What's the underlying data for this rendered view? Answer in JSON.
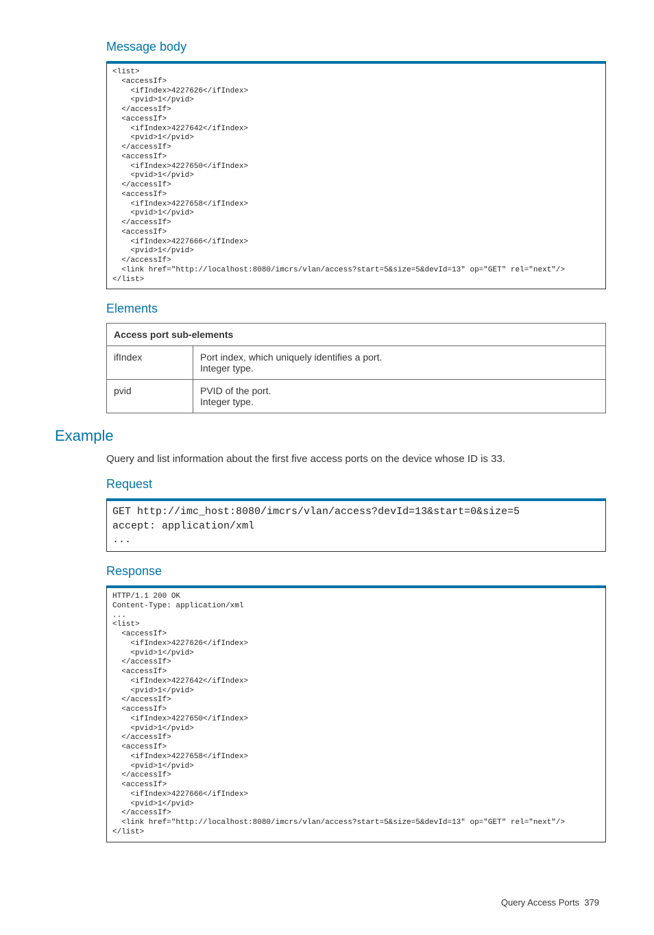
{
  "headings": {
    "messageBody": "Message body",
    "elements": "Elements",
    "example": "Example",
    "request": "Request",
    "response": "Response"
  },
  "code": {
    "messageBody": "<list>\n  <accessIf>\n    <ifIndex>4227626</ifIndex>\n    <pvid>1</pvid>\n  </accessIf>\n  <accessIf>\n    <ifIndex>4227642</ifIndex>\n    <pvid>1</pvid>\n  </accessIf>\n  <accessIf>\n    <ifIndex>4227650</ifIndex>\n    <pvid>1</pvid>\n  </accessIf>\n  <accessIf>\n    <ifIndex>4227658</ifIndex>\n    <pvid>1</pvid>\n  </accessIf>\n  <accessIf>\n    <ifIndex>4227666</ifIndex>\n    <pvid>1</pvid>\n  </accessIf>\n  <link href=\"http://localhost:8080/imcrs/vlan/access?start=5&size=5&devId=13\" op=\"GET\" rel=\"next\"/>\n</list>",
    "request": "GET http://imc_host:8080/imcrs/vlan/access?devId=13&start=0&size=5\naccept: application/xml\n...",
    "response": "HTTP/1.1 200 OK\nContent-Type: application/xml\n...\n<list>\n  <accessIf>\n    <ifIndex>4227626</ifIndex>\n    <pvid>1</pvid>\n  </accessIf>\n  <accessIf>\n    <ifIndex>4227642</ifIndex>\n    <pvid>1</pvid>\n  </accessIf>\n  <accessIf>\n    <ifIndex>4227650</ifIndex>\n    <pvid>1</pvid>\n  </accessIf>\n  <accessIf>\n    <ifIndex>4227658</ifIndex>\n    <pvid>1</pvid>\n  </accessIf>\n  <accessIf>\n    <ifIndex>4227666</ifIndex>\n    <pvid>1</pvid>\n  </accessIf>\n  <link href=\"http://localhost:8080/imcrs/vlan/access?start=5&size=5&devId=13\" op=\"GET\" rel=\"next\"/>\n</list>"
  },
  "table": {
    "header": "Access port sub-elements",
    "rows": [
      {
        "name": "ifIndex",
        "desc": "Port index, which uniquely identifies a port.\nInteger type."
      },
      {
        "name": "pvid",
        "desc": "PVID of the port.\nInteger type."
      }
    ]
  },
  "exampleText": "Query and list information about the first five access ports on the device whose ID is 33.",
  "footer": {
    "title": "Query Access Ports",
    "page": "379"
  }
}
